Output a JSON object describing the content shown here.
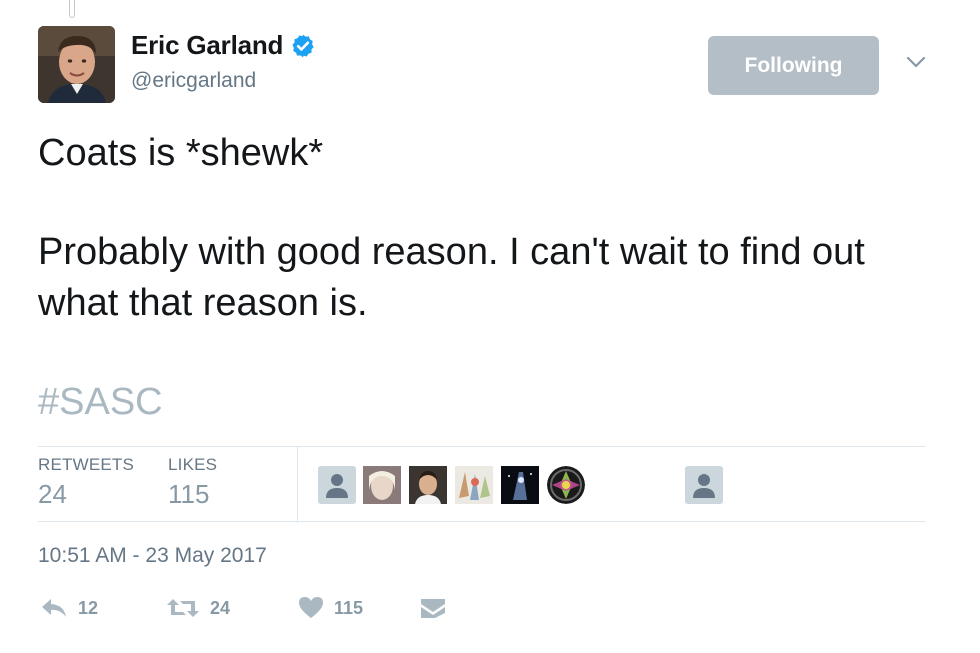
{
  "header": {
    "display_name": "Eric Garland",
    "handle": "@ericgarland",
    "verified": true,
    "follow_button_label": "Following"
  },
  "tweet": {
    "paragraphs": [
      "Coats is *shewk*",
      "Probably with good reason. I can't wait to find out what that reason is."
    ],
    "hashtag": "#SASC"
  },
  "stats": {
    "retweets_label": "RETWEETS",
    "retweets_count": "24",
    "likes_label": "LIKES",
    "likes_count": "115"
  },
  "liked_by_avatars": [
    "default-avatar",
    "photo-avatar",
    "photo-avatar",
    "photo-avatar",
    "photo-avatar",
    "pattern-avatar",
    "default-avatar"
  ],
  "timestamp": "10:51 AM - 23 May 2017",
  "actions": {
    "reply_count": "12",
    "retweet_count": "24",
    "like_count": "115"
  },
  "colors": {
    "hashtag": "#aab8c2",
    "follow_button_bg": "#b3bec7",
    "verified_badge": "#1da1f2",
    "secondary_text": "#657786",
    "action_icon": "#aab8c2"
  }
}
